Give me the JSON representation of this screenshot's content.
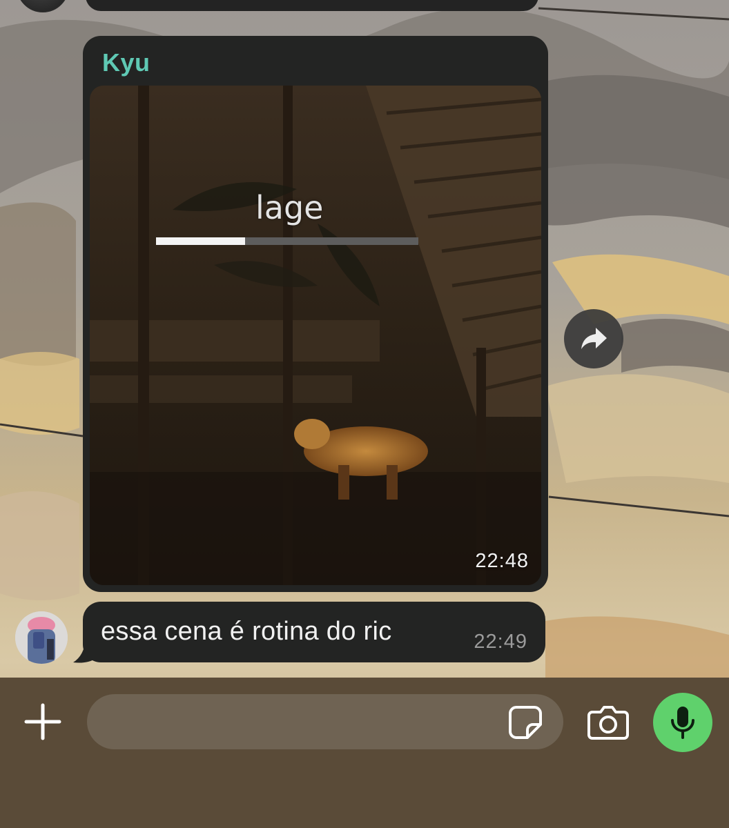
{
  "chat": {
    "messages": [
      {
        "sender": "Kyu",
        "type": "video",
        "video_overlay_text": "lage",
        "video_progress": 0.34,
        "time": "22:48"
      },
      {
        "type": "text",
        "text": "essa cena é rotina do ric",
        "time": "22:49"
      }
    ]
  },
  "composer": {
    "input_value": "",
    "placeholder": "",
    "icons": {
      "add": "plus-icon",
      "sticker": "sticker-icon",
      "camera": "camera-icon",
      "mic": "mic-icon"
    }
  },
  "icons": {
    "forward": "forward-arrow-icon"
  },
  "colors": {
    "sender_name": "#5fc9b4",
    "bubble": "#232423",
    "mic_button": "#5fd16c",
    "composer_bg": "#5a4b38"
  }
}
